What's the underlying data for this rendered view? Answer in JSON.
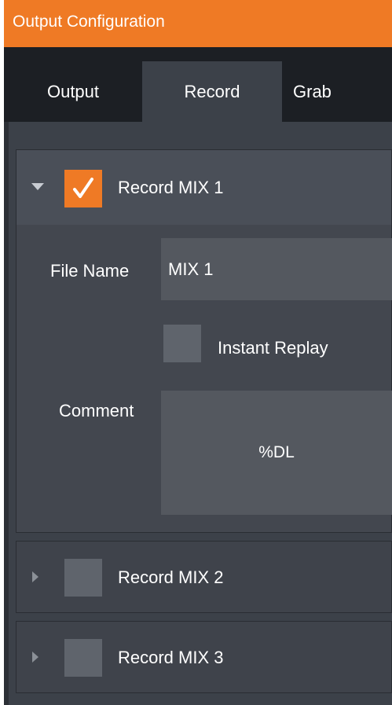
{
  "window": {
    "title": "Output Configuration"
  },
  "tabs": [
    {
      "label": "Output",
      "active": false
    },
    {
      "label": "Record",
      "active": true
    },
    {
      "label": "Grab",
      "active": false
    }
  ],
  "sections": [
    {
      "label": "Record MIX 1",
      "checked": true,
      "expanded": true,
      "file_name_label": "File Name",
      "file_name_value": "MIX 1",
      "instant_replay_label": "Instant Replay",
      "instant_replay_checked": false,
      "comment_label": "Comment",
      "comment_value": "%DL"
    },
    {
      "label": "Record MIX 2",
      "checked": false,
      "expanded": false
    },
    {
      "label": "Record MIX 3",
      "checked": false,
      "expanded": false
    }
  ],
  "colors": {
    "accent": "#ef7a25",
    "panel": "#3c4149",
    "tabstrip": "#1c1f24",
    "input": "#54585f"
  },
  "icons": {
    "expand": "triangle-down-icon",
    "collapsed": "triangle-right-icon",
    "check": "checkmark-icon"
  }
}
